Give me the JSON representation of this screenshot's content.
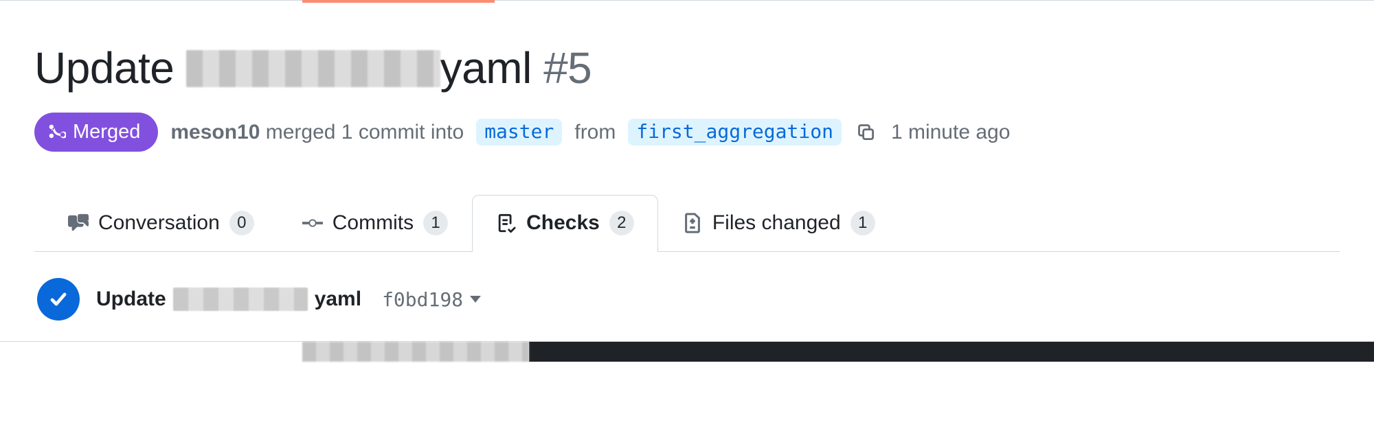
{
  "pr": {
    "title_prefix": "Update",
    "title_suffix": "yaml",
    "number": "#5"
  },
  "state_badge": {
    "label": "Merged"
  },
  "meta": {
    "author": "meson10",
    "merged_text_1": "merged 1 commit into",
    "base_branch": "master",
    "from_word": "from",
    "head_branch": "first_aggregation",
    "time_ago": "1 minute ago"
  },
  "tabs": {
    "conversation": {
      "label": "Conversation",
      "count": "0"
    },
    "commits": {
      "label": "Commits",
      "count": "1"
    },
    "checks": {
      "label": "Checks",
      "count": "2"
    },
    "files": {
      "label": "Files changed",
      "count": "1"
    }
  },
  "commit_row": {
    "title_prefix": "Update",
    "title_suffix": "yaml",
    "sha": "f0bd198"
  }
}
